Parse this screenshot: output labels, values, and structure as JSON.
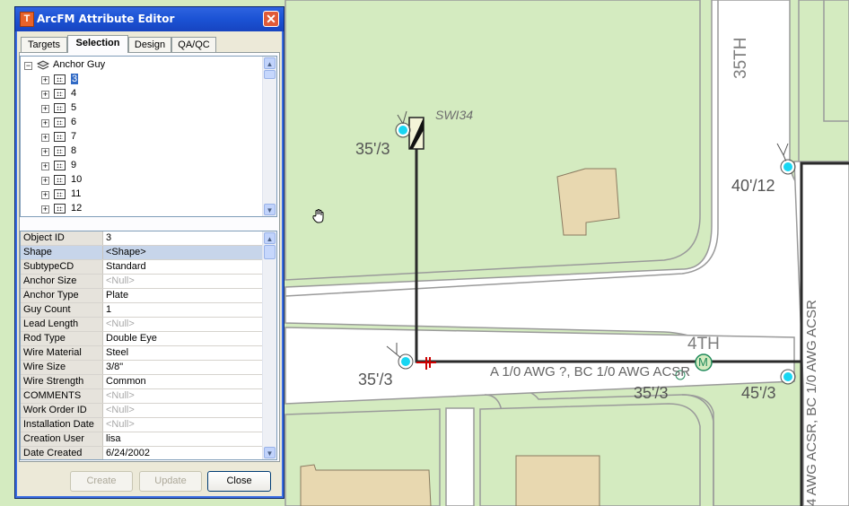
{
  "window": {
    "title": "ArcFM Attribute Editor",
    "icon_letter": "T",
    "close_glyph": "✕"
  },
  "tabs": [
    {
      "label": "Targets",
      "active": false
    },
    {
      "label": "Selection",
      "active": true
    },
    {
      "label": "Design",
      "active": false
    },
    {
      "label": "QA/QC",
      "active": false
    }
  ],
  "tree": {
    "root_label": "Anchor Guy",
    "items": [
      "3",
      "4",
      "5",
      "6",
      "7",
      "8",
      "9",
      "10",
      "11",
      "12"
    ],
    "selected_item": "3"
  },
  "attributes": [
    {
      "name": "Object ID",
      "value": "3",
      "null": false,
      "selected": false
    },
    {
      "name": "Shape",
      "value": "<Shape>",
      "null": false,
      "selected": true
    },
    {
      "name": "SubtypeCD",
      "value": "Standard",
      "null": false,
      "selected": false
    },
    {
      "name": "Anchor Size",
      "value": "<Null>",
      "null": true,
      "selected": false
    },
    {
      "name": "Anchor Type",
      "value": "Plate",
      "null": false,
      "selected": false
    },
    {
      "name": "Guy Count",
      "value": "1",
      "null": false,
      "selected": false
    },
    {
      "name": "Lead Length",
      "value": "<Null>",
      "null": true,
      "selected": false
    },
    {
      "name": "Rod Type",
      "value": "Double Eye",
      "null": false,
      "selected": false
    },
    {
      "name": "Wire Material",
      "value": "Steel",
      "null": false,
      "selected": false
    },
    {
      "name": "Wire Size",
      "value": "3/8\"",
      "null": false,
      "selected": false
    },
    {
      "name": "Wire Strength",
      "value": "Common",
      "null": false,
      "selected": false
    },
    {
      "name": "COMMENTS",
      "value": "<Null>",
      "null": true,
      "selected": false
    },
    {
      "name": "Work Order ID",
      "value": "<Null>",
      "null": true,
      "selected": false
    },
    {
      "name": "Installation Date",
      "value": "<Null>",
      "null": true,
      "selected": false
    },
    {
      "name": "Creation User",
      "value": "lisa",
      "null": false,
      "selected": false
    },
    {
      "name": "Date Created",
      "value": "6/24/2002",
      "null": false,
      "selected": false
    }
  ],
  "buttons": {
    "create": "Create",
    "update": "Update",
    "close": "Close"
  },
  "map": {
    "street_35th": "35TH",
    "street_4th": "4TH",
    "switch_label": "SWI34",
    "pole_labels": [
      "35'/3",
      "40'/12",
      "35'/3",
      "35'/3",
      "45'/3"
    ],
    "line_label_horizontal": "A 1/0 AWG ?, BC 1/0 AWG ACSR",
    "line_label_vertical": "4 AWG ACSR, BC 1/0 AWG ACSR",
    "meter_letter": "M",
    "colors": {
      "grass": "#d4ebc0",
      "road": "#ffffff",
      "road_edge": "#9a9a9a",
      "building_fill": "#e8d8b0",
      "building_edge": "#8a7a60",
      "conductor": "#2a2a2a",
      "pole": "#18d6f2",
      "meter": "#1f8a5a",
      "fuse": "#cc0000"
    }
  }
}
